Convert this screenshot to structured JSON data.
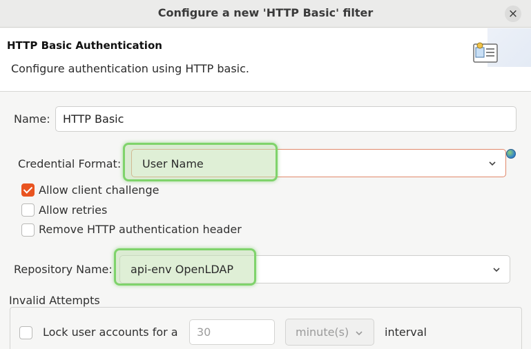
{
  "window": {
    "title": "Configure a new 'HTTP Basic' filter",
    "close_symbol": "×"
  },
  "header": {
    "title": "HTTP Basic Authentication",
    "description": "Configure authentication using HTTP basic.",
    "icon": "certificate-document-icon"
  },
  "form": {
    "name_label": "Name:",
    "name_value": "HTTP Basic",
    "credential_format_label": "Credential Format:",
    "credential_format_value": "User Name",
    "allow_client_challenge_label": "Allow client challenge",
    "allow_client_challenge_checked": true,
    "allow_retries_label": "Allow retries",
    "allow_retries_checked": false,
    "remove_header_label": "Remove HTTP authentication header",
    "remove_header_checked": false,
    "repository_name_label": "Repository Name:",
    "repository_name_value": "api-env OpenLDAP"
  },
  "invalid_attempts": {
    "group_label": "Invalid Attempts",
    "lock_label": "Lock user accounts for a",
    "lock_checked": false,
    "amount_value": "30",
    "unit_value": "minute(s)",
    "interval_label": "interval"
  },
  "colors": {
    "accent": "#e95420",
    "highlight": "#7fd36b",
    "error_border": "#e0876a"
  }
}
